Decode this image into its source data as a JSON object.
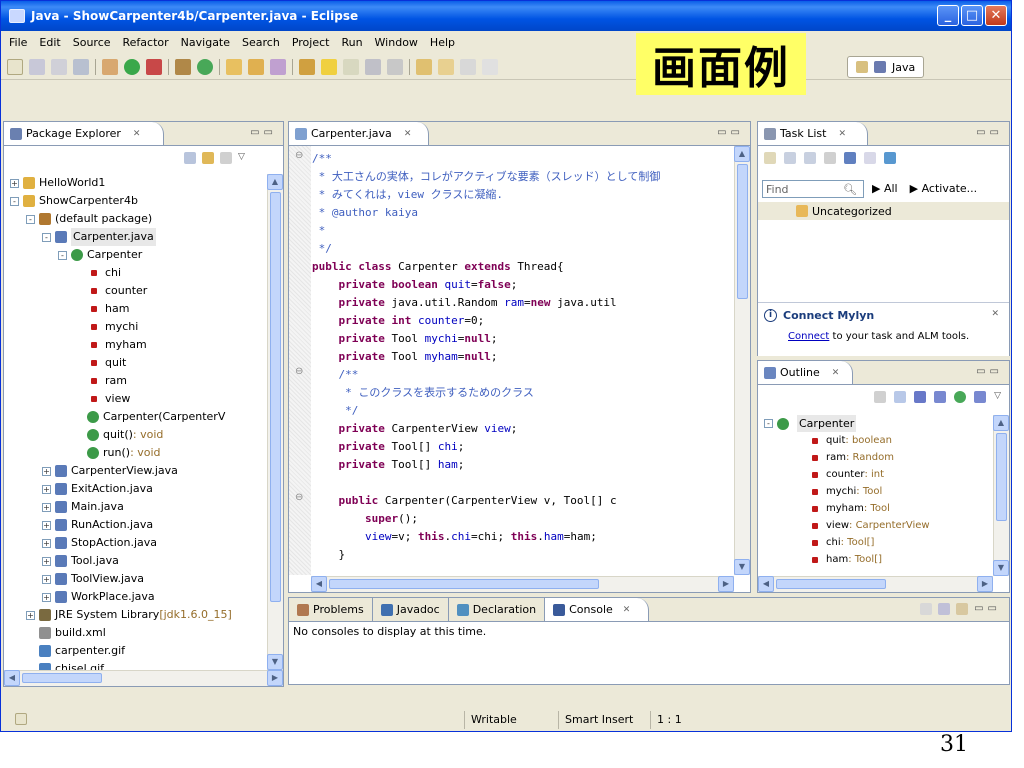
{
  "window": {
    "title": "Java - ShowCarpenter4b/Carpenter.java - Eclipse",
    "overlay_label": "画面例",
    "minimize": "_",
    "maximize": "□",
    "close": "✕"
  },
  "menu": [
    "File",
    "Edit",
    "Source",
    "Refactor",
    "Navigate",
    "Search",
    "Project",
    "Run",
    "Window",
    "Help"
  ],
  "perspective": "Java",
  "package_explorer": {
    "tab_label": "Package Explorer",
    "tab_close": "✕",
    "tree": [
      {
        "indent": 0,
        "exp": "+",
        "icon": "project",
        "label": "HelloWorld1"
      },
      {
        "indent": 0,
        "exp": "-",
        "icon": "project",
        "label": "ShowCarpenter4b"
      },
      {
        "indent": 1,
        "exp": "-",
        "icon": "package",
        "label": "(default package)"
      },
      {
        "indent": 2,
        "exp": "-",
        "icon": "java",
        "label": "Carpenter.java",
        "selected": true
      },
      {
        "indent": 3,
        "exp": "-",
        "icon": "class",
        "label": "Carpenter"
      },
      {
        "indent": 4,
        "icon": "field",
        "label": "chi"
      },
      {
        "indent": 4,
        "icon": "field",
        "label": "counter"
      },
      {
        "indent": 4,
        "icon": "field",
        "label": "ham"
      },
      {
        "indent": 4,
        "icon": "field",
        "label": "mychi"
      },
      {
        "indent": 4,
        "icon": "field",
        "label": "myham"
      },
      {
        "indent": 4,
        "icon": "field",
        "label": "quit"
      },
      {
        "indent": 4,
        "icon": "field",
        "label": "ram"
      },
      {
        "indent": 4,
        "icon": "field",
        "label": "view"
      },
      {
        "indent": 4,
        "icon": "ctor",
        "label": "Carpenter(CarpenterV"
      },
      {
        "indent": 4,
        "icon": "method",
        "label": "quit()",
        "suffix": " : void"
      },
      {
        "indent": 4,
        "icon": "method",
        "label": "run()",
        "suffix": " : void"
      },
      {
        "indent": 2,
        "exp": "+",
        "icon": "java",
        "label": "CarpenterView.java"
      },
      {
        "indent": 2,
        "exp": "+",
        "icon": "java",
        "label": "ExitAction.java"
      },
      {
        "indent": 2,
        "exp": "+",
        "icon": "java",
        "label": "Main.java"
      },
      {
        "indent": 2,
        "exp": "+",
        "icon": "java",
        "label": "RunAction.java"
      },
      {
        "indent": 2,
        "exp": "+",
        "icon": "java",
        "label": "StopAction.java"
      },
      {
        "indent": 2,
        "exp": "+",
        "icon": "java",
        "label": "Tool.java"
      },
      {
        "indent": 2,
        "exp": "+",
        "icon": "java",
        "label": "ToolView.java"
      },
      {
        "indent": 2,
        "exp": "+",
        "icon": "java",
        "label": "WorkPlace.java"
      },
      {
        "indent": 1,
        "exp": "+",
        "icon": "library",
        "label": "JRE System Library",
        "suffix": " [jdk1.6.0_15]"
      },
      {
        "indent": 1,
        "icon": "xml",
        "label": "build.xml"
      },
      {
        "indent": 1,
        "icon": "gif",
        "label": "carpenter.gif"
      },
      {
        "indent": 1,
        "icon": "gif",
        "label": "chisel.gif"
      }
    ]
  },
  "editor": {
    "tab_label": "Carpenter.java",
    "tab_close": "✕",
    "lines": [
      [
        {
          "t": "/**",
          "c": "cm"
        }
      ],
      [
        {
          "t": " * 大工さんの実体，コレがアクティブな要素（スレッド）として制御",
          "c": "cm"
        }
      ],
      [
        {
          "t": " * みてくれは，view クラスに凝縮.",
          "c": "cm"
        }
      ],
      [
        {
          "t": " * @author kaiya",
          "c": "cm"
        }
      ],
      [
        {
          "t": " *",
          "c": "cm"
        }
      ],
      [
        {
          "t": " */",
          "c": "cm"
        }
      ],
      [
        {
          "t": "public class ",
          "c": "kw"
        },
        {
          "t": "Carpenter ",
          "c": ""
        },
        {
          "t": "extends ",
          "c": "kw"
        },
        {
          "t": "Thread{",
          "c": ""
        }
      ],
      [
        {
          "t": "    private boolean ",
          "c": "kw"
        },
        {
          "t": "quit",
          "c": "fd"
        },
        {
          "t": "=",
          "c": ""
        },
        {
          "t": "false",
          "c": "kw"
        },
        {
          "t": ";",
          "c": ""
        }
      ],
      [
        {
          "t": "    private ",
          "c": "kw"
        },
        {
          "t": "java.util.Random ",
          "c": ""
        },
        {
          "t": "ram",
          "c": "fd"
        },
        {
          "t": "=",
          "c": ""
        },
        {
          "t": "new ",
          "c": "kw"
        },
        {
          "t": "java.util",
          "c": ""
        }
      ],
      [
        {
          "t": "    private int ",
          "c": "kw"
        },
        {
          "t": "counter",
          "c": "fd"
        },
        {
          "t": "=0;",
          "c": ""
        }
      ],
      [
        {
          "t": "    private ",
          "c": "kw"
        },
        {
          "t": "Tool ",
          "c": ""
        },
        {
          "t": "mychi",
          "c": "fd"
        },
        {
          "t": "=",
          "c": ""
        },
        {
          "t": "null",
          "c": "kw"
        },
        {
          "t": ";",
          "c": ""
        }
      ],
      [
        {
          "t": "    private ",
          "c": "kw"
        },
        {
          "t": "Tool ",
          "c": ""
        },
        {
          "t": "myham",
          "c": "fd"
        },
        {
          "t": "=",
          "c": ""
        },
        {
          "t": "null",
          "c": "kw"
        },
        {
          "t": ";",
          "c": ""
        }
      ],
      [
        {
          "t": "    /**",
          "c": "cm"
        }
      ],
      [
        {
          "t": "     * このクラスを表示するためのクラス",
          "c": "cm"
        }
      ],
      [
        {
          "t": "     */",
          "c": "cm"
        }
      ],
      [
        {
          "t": "    private ",
          "c": "kw"
        },
        {
          "t": "CarpenterView ",
          "c": ""
        },
        {
          "t": "view",
          "c": "fd"
        },
        {
          "t": ";",
          "c": ""
        }
      ],
      [
        {
          "t": "    private ",
          "c": "kw"
        },
        {
          "t": "Tool[] ",
          "c": ""
        },
        {
          "t": "chi",
          "c": "fd"
        },
        {
          "t": ";",
          "c": ""
        }
      ],
      [
        {
          "t": "    private ",
          "c": "kw"
        },
        {
          "t": "Tool[] ",
          "c": ""
        },
        {
          "t": "ham",
          "c": "fd"
        },
        {
          "t": ";",
          "c": ""
        }
      ],
      [
        {
          "t": "",
          "c": ""
        }
      ],
      [
        {
          "t": "    public ",
          "c": "kw"
        },
        {
          "t": "Carpenter(CarpenterView v, Tool[] c",
          "c": ""
        }
      ],
      [
        {
          "t": "        super",
          "c": "kw"
        },
        {
          "t": "();",
          "c": ""
        }
      ],
      [
        {
          "t": "        ",
          "c": ""
        },
        {
          "t": "view",
          "c": "fd"
        },
        {
          "t": "=v; ",
          "c": ""
        },
        {
          "t": "this",
          "c": "kw"
        },
        {
          "t": ".",
          "c": ""
        },
        {
          "t": "chi",
          "c": "fd"
        },
        {
          "t": "=chi; ",
          "c": ""
        },
        {
          "t": "this",
          "c": "kw"
        },
        {
          "t": ".",
          "c": ""
        },
        {
          "t": "ham",
          "c": "fd"
        },
        {
          "t": "=ham;",
          "c": ""
        }
      ],
      [
        {
          "t": "    }",
          "c": ""
        }
      ]
    ]
  },
  "task_list": {
    "tab_label": "Task List",
    "tab_close": "✕",
    "find_placeholder": "Find",
    "all_label": "All",
    "activate_label": "Activate...",
    "category": "Uncategorized"
  },
  "mylyn": {
    "title": "Connect Mylyn",
    "link": "Connect",
    "text": " to your task and ALM tools."
  },
  "outline": {
    "tab_label": "Outline",
    "tab_close": "✕",
    "class_name": "Carpenter",
    "items": [
      {
        "name": "quit",
        "type": " : boolean"
      },
      {
        "name": "ram",
        "type": " : Random"
      },
      {
        "name": "counter",
        "type": " : int"
      },
      {
        "name": "mychi",
        "type": " : Tool"
      },
      {
        "name": "myham",
        "type": " : Tool"
      },
      {
        "name": "view",
        "type": " : CarpenterView"
      },
      {
        "name": "chi",
        "type": " : Tool[]"
      },
      {
        "name": "ham",
        "type": " : Tool[]"
      }
    ]
  },
  "console": {
    "tabs": [
      {
        "label": "Problems",
        "icon": "problems-icon"
      },
      {
        "label": "Javadoc",
        "icon": "javadoc-icon"
      },
      {
        "label": "Declaration",
        "icon": "declaration-icon"
      },
      {
        "label": "Console",
        "icon": "console-icon",
        "active": true
      }
    ],
    "tab_close": "✕",
    "message": "No consoles to display at this time."
  },
  "status": {
    "writable": "Writable",
    "insert_mode": "Smart Insert",
    "position": "1 : 1"
  },
  "slide_number": "31",
  "colors": {
    "title_bar": "#0054e3",
    "keyword": "#7f0055",
    "comment": "#3f5fbf",
    "field": "#0000c0",
    "overlay": "#ffff66"
  }
}
